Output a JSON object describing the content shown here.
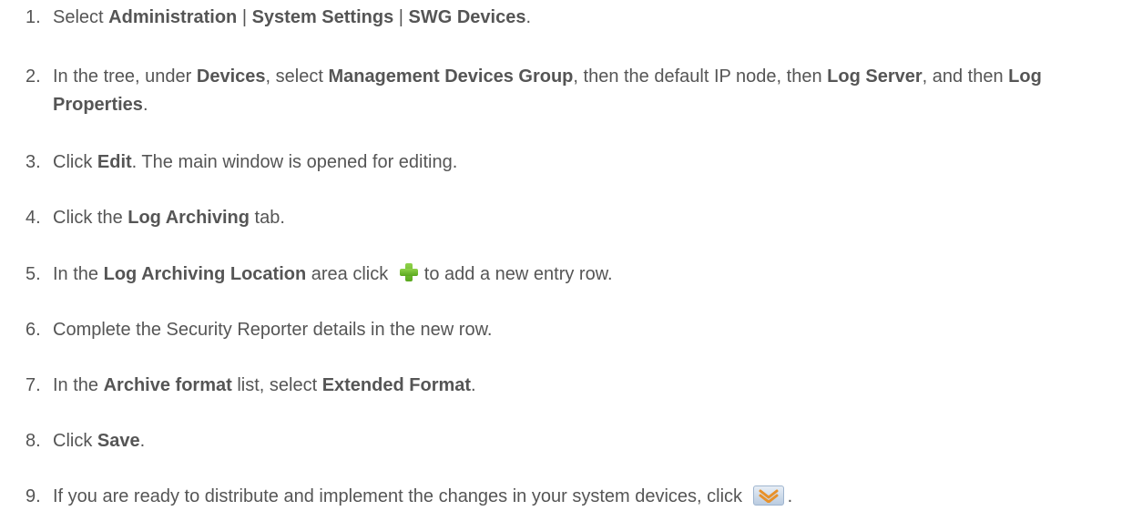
{
  "steps": [
    {
      "num": "1.",
      "t1": "Select ",
      "b1": "Administration",
      "t2": " | ",
      "b2": "System Settings",
      "t3": " | ",
      "b3": "SWG Devices",
      "t4": "."
    },
    {
      "num": "2.",
      "t1": "In the tree, under ",
      "b1": "Devices",
      "t2": ", select ",
      "b2": "Management Devices Group",
      "t3": ", then the default IP node, then ",
      "b3": "Log Server",
      "t4": ", and then ",
      "b4": "Log Properties",
      "t5": "."
    },
    {
      "num": "3.",
      "t1": "Click ",
      "b1": "Edit",
      "t2": ". The main window is opened for editing."
    },
    {
      "num": "4.",
      "t1": "Click the ",
      "b1": "Log Archiving",
      "t2": " tab."
    },
    {
      "num": "5.",
      "t1": "In the ",
      "b1": "Log Archiving Location",
      "t2": " area click ",
      "icon": "add-icon",
      "t3": "to add a new entry row."
    },
    {
      "num": "6.",
      "t1": "Complete the Security Reporter details in the new row."
    },
    {
      "num": "7.",
      "t1": "In the ",
      "b1": "Archive format",
      "t2": " list, select ",
      "b2": "Extended Format",
      "t3": "."
    },
    {
      "num": "8.",
      "t1": "Click ",
      "b1": "Save",
      "t2": "."
    },
    {
      "num": "9.",
      "t1": "If you are ready to distribute and implement the changes in your system devices, click ",
      "icon": "distribute-icon",
      "t2": "."
    }
  ],
  "colors": {
    "text": "#555555",
    "add_icon": "#6fbf2a",
    "distribute_icon_arrow": "#e8912a"
  }
}
